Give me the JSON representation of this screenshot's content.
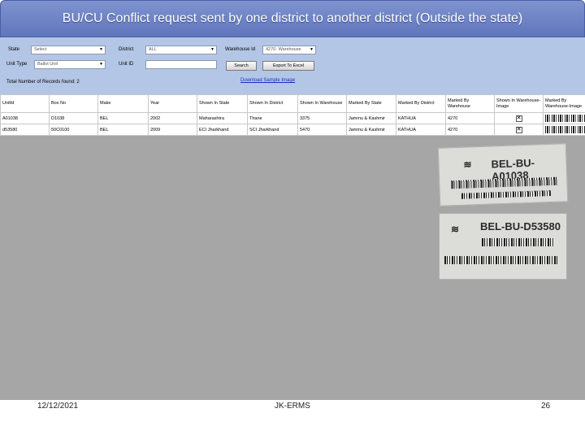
{
  "slide": {
    "title": "BU/CU Conflict request sent by one district to another district (Outside the state)",
    "date": "12/12/2021",
    "center": "JK-ERMS",
    "page_number": "26"
  },
  "filters": {
    "state_label": "State",
    "state_value": "Select",
    "district_label": "District",
    "district_value": "ALL",
    "warehouse_label": "Warehouse Id",
    "warehouse_value": "4270- Warehouse",
    "unit_type_label": "Unit Type",
    "unit_type_value": "Ballot Unit",
    "unit_id_label": "Unit ID",
    "unit_id_value": "",
    "search_label": "Search",
    "export_label": "Export To Excel",
    "total_label": "Total Number of Records found: 2",
    "download_link": "Download Sample Image"
  },
  "table": {
    "headers": [
      "UnitId",
      "Box No",
      "Make",
      "Year",
      "Shown In State",
      "Shown In District",
      "Shown In Warehouse",
      "Marked By State",
      "Marked By District",
      "Marked By Warehouse",
      "Shown In Warehouse-Image",
      "Marked By Warehouse-Image"
    ],
    "rows": [
      [
        "A01038",
        "D1038",
        "BEL",
        "2002",
        "Maharashtra",
        "Thane",
        "3375",
        "Jammu & Kashmir",
        "KATHUA",
        "4270"
      ],
      [
        "d53580",
        "50C0100",
        "BEL",
        "2009",
        "ECI Jharkhand",
        "SCI Jharkhand",
        "5470",
        "Jammu & Kashmir",
        "KATHUA",
        "4270"
      ]
    ]
  },
  "photos": [
    {
      "code": "BEL-BU-A01038"
    },
    {
      "code": "BEL-BU-D53580"
    }
  ]
}
